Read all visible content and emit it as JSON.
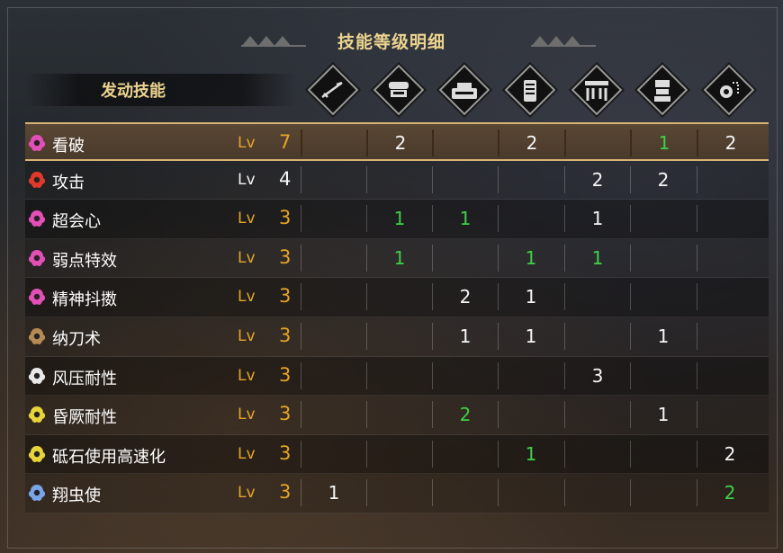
{
  "title": "技能等级明细",
  "header": {
    "skills_label": "发动技能"
  },
  "equipment_icons": [
    "weapon-icon",
    "helm-icon",
    "chest-icon",
    "arms-icon",
    "waist-icon",
    "legs-icon",
    "talisman-icon"
  ],
  "lv_label": "Lv",
  "skills": [
    {
      "name": "看破",
      "icon_color": "#e34fb6",
      "level": "7",
      "level_color": "orange",
      "selected": true,
      "points": [
        "",
        "2",
        "",
        "2",
        "",
        "1",
        "2"
      ],
      "point_colors": [
        "",
        "white",
        "",
        "white",
        "",
        "green",
        "white"
      ]
    },
    {
      "name": "攻击",
      "icon_color": "#e0392a",
      "level": "4",
      "level_color": "white",
      "selected": false,
      "points": [
        "",
        "",
        "",
        "",
        "2",
        "2",
        ""
      ],
      "point_colors": [
        "",
        "",
        "",
        "",
        "white",
        "white",
        ""
      ]
    },
    {
      "name": "超会心",
      "icon_color": "#e34fb6",
      "level": "3",
      "level_color": "orange",
      "selected": false,
      "points": [
        "",
        "1",
        "1",
        "",
        "1",
        "",
        ""
      ],
      "point_colors": [
        "",
        "green",
        "green",
        "",
        "white",
        "",
        ""
      ]
    },
    {
      "name": "弱点特效",
      "icon_color": "#e34fb6",
      "level": "3",
      "level_color": "orange",
      "selected": false,
      "points": [
        "",
        "1",
        "",
        "1",
        "1",
        "",
        ""
      ],
      "point_colors": [
        "",
        "green",
        "",
        "green",
        "green",
        "",
        ""
      ]
    },
    {
      "name": "精神抖擞",
      "icon_color": "#e34fb6",
      "level": "3",
      "level_color": "orange",
      "selected": false,
      "points": [
        "",
        "",
        "2",
        "1",
        "",
        "",
        ""
      ],
      "point_colors": [
        "",
        "",
        "white",
        "white",
        "",
        "",
        ""
      ]
    },
    {
      "name": "纳刀术",
      "icon_color": "#b58a54",
      "level": "3",
      "level_color": "orange",
      "selected": false,
      "points": [
        "",
        "",
        "1",
        "1",
        "",
        "1",
        ""
      ],
      "point_colors": [
        "",
        "",
        "white",
        "white",
        "",
        "white",
        ""
      ]
    },
    {
      "name": "风压耐性",
      "icon_color": "#e8e8e8",
      "level": "3",
      "level_color": "orange",
      "selected": false,
      "points": [
        "",
        "",
        "",
        "",
        "3",
        "",
        ""
      ],
      "point_colors": [
        "",
        "",
        "",
        "",
        "white",
        "",
        ""
      ]
    },
    {
      "name": "昏厥耐性",
      "icon_color": "#e6d43a",
      "level": "3",
      "level_color": "orange",
      "selected": false,
      "points": [
        "",
        "",
        "2",
        "",
        "",
        "1",
        ""
      ],
      "point_colors": [
        "",
        "",
        "green",
        "",
        "",
        "white",
        ""
      ]
    },
    {
      "name": "砥石使用高速化",
      "icon_color": "#e6d43a",
      "level": "3",
      "level_color": "orange",
      "selected": false,
      "points": [
        "",
        "",
        "",
        "1",
        "",
        "",
        "2"
      ],
      "point_colors": [
        "",
        "",
        "",
        "green",
        "",
        "",
        "white"
      ]
    },
    {
      "name": "翔虫使",
      "icon_color": "#7aa4e8",
      "level": "3",
      "level_color": "orange",
      "selected": false,
      "points": [
        "1",
        "",
        "",
        "",
        "",
        "",
        "2"
      ],
      "point_colors": [
        "white",
        "",
        "",
        "",
        "",
        "",
        "green"
      ]
    }
  ],
  "colors": {
    "title_gold": "#ecd38f",
    "level_orange": "#e6a428",
    "decoration_green": "#3fd046",
    "selected_border": "#d6b574"
  }
}
